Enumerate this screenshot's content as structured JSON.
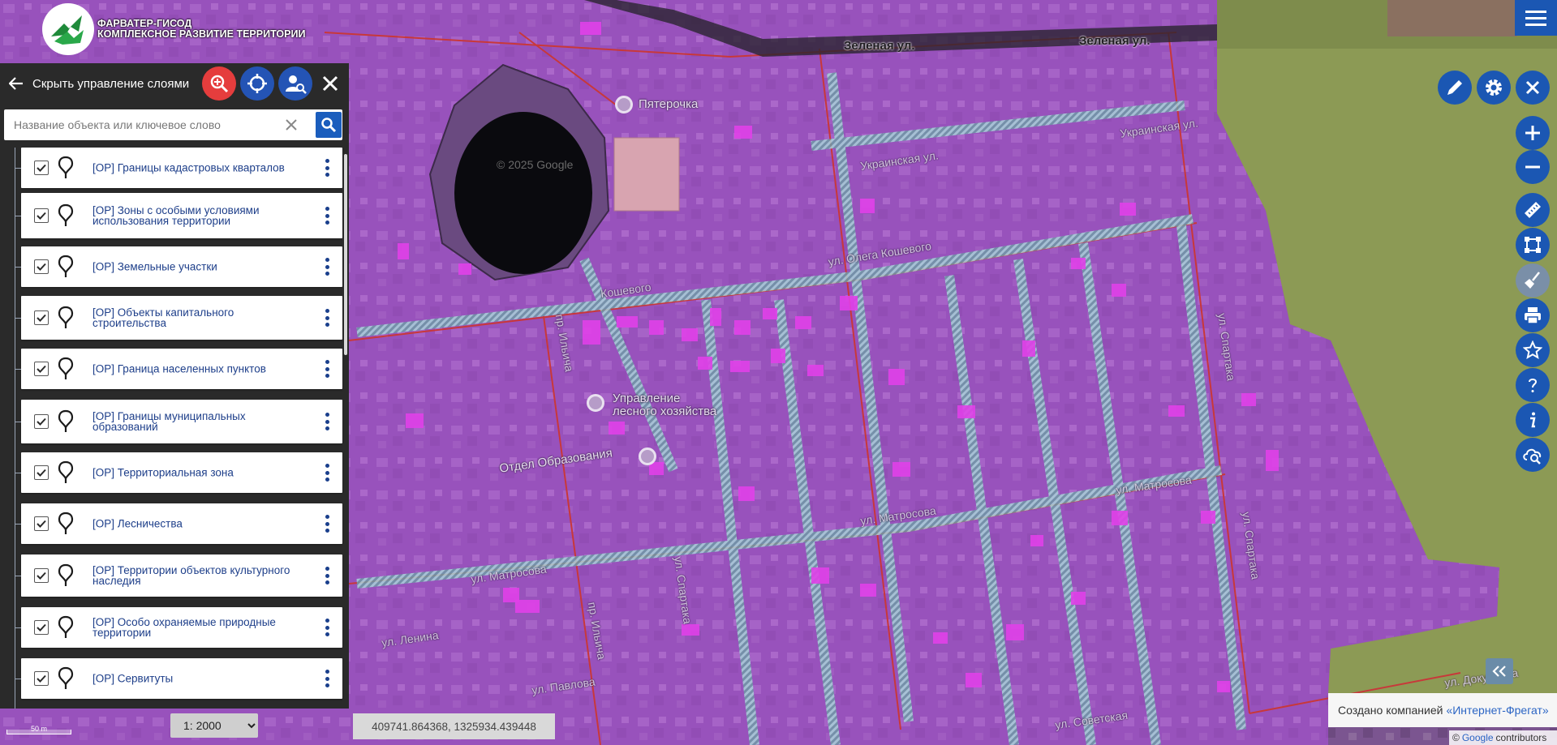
{
  "app": {
    "logo_line1": "ФАРВАТЕР-ГИСОД",
    "logo_line2": "КОМПЛЕКСНОЕ РАЗВИТИЕ ТЕРРИТОРИИ"
  },
  "panel": {
    "title": "Скрыть управление слоями",
    "search_placeholder": "Название объекта или ключевое слово"
  },
  "layers": [
    {
      "label": "[ОР] Границы кадастровых кварталов",
      "checked": true
    },
    {
      "label": "[ОР] Зоны с особыми условиями использования территории",
      "checked": true
    },
    {
      "label": "[ОР] Земельные участки",
      "checked": true
    },
    {
      "label": "[ОР] Объекты капитального строительства",
      "checked": true
    },
    {
      "label": "[ОР] Граница населенных пунктов",
      "checked": true
    },
    {
      "label": "[ОР] Границы муниципальных образований",
      "checked": true
    },
    {
      "label": "[ОР] Территориальная зона",
      "checked": true
    },
    {
      "label": "[ОР] Лесничества",
      "checked": true
    },
    {
      "label": "[ОР] Территории объектов культурного наследия",
      "checked": true
    },
    {
      "label": "[ОР] Особо охраняемые природные территории",
      "checked": true
    },
    {
      "label": "[ОР] Сервитуты",
      "checked": true
    }
  ],
  "map": {
    "streets": {
      "zelenaya_1": "Зеленая ул.",
      "zelenaya_2": "Зеленая ул.",
      "ukrainskaya_1": "Украинская ул.",
      "ukrainskaya_2": "Украинская ул.",
      "koshevogo_1": "ул. Олега Кошевого",
      "koshevogo_2": "Кошевого",
      "ilyicha_1": "пр. Ильича",
      "ilyicha_2": "пр. Ильича",
      "matrosova_1": "ул. Матросова",
      "matrosova_2": "ул. Матросова",
      "matrosova_3": "ул. Матросова",
      "spartaka_1": "ул. Спартака",
      "spartaka_2": "ул. Спартака",
      "spartaka_3": "ул. Спартака",
      "obrazovaniya": "Отдел Образования",
      "lenina": "ул. Ленина",
      "pavlova": "ул. Павлова",
      "dokuchaeva": "ул. Докучаева",
      "sovetskaya": "ул. Советская"
    },
    "poi": {
      "pyaterochka": "Пятерочка",
      "forest_line1": "Управление",
      "forest_line2": "лесного хозяйства"
    },
    "watermark": "© 2025 Google"
  },
  "status": {
    "scale_bar": "50 m",
    "scale_selected": "1: 2000",
    "coords": "409741.864368, 1325934.439448"
  },
  "credit": {
    "prefix": "Создано компанией",
    "company": "«Интернет-Фрегат»",
    "attrib_symbol": "©",
    "attrib_google": "Google",
    "attrib_suffix": "contributors"
  },
  "colors": {
    "overlay": "#a04ad0",
    "road_red": "#c8383a",
    "accent_blue": "#1b57b3",
    "accent_red": "#e53d3d",
    "layer_text": "#1e3f8a"
  },
  "icons": {
    "menu": "hamburger-icon",
    "edit": "pencil-icon",
    "settings": "gear-icon",
    "close": "close-icon",
    "zoom_in": "plus-icon",
    "zoom_out": "minus-icon",
    "measure": "ruler-icon",
    "select": "polygon-select-icon",
    "clear": "broom-icon",
    "print": "printer-icon",
    "favorites": "star-icon",
    "help": "question-icon",
    "info": "info-icon",
    "cloud_search": "cloud-search-icon"
  }
}
